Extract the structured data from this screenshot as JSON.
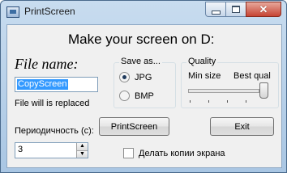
{
  "window": {
    "title": "PrintScreen"
  },
  "heading": "Make your screen on D:",
  "file": {
    "label": "File name:",
    "value": "CopyScreen",
    "note": "File will is replaced"
  },
  "save_as": {
    "title": "Save as...",
    "options": [
      "JPG",
      "BMP"
    ],
    "selected": "JPG"
  },
  "quality": {
    "title": "Quality",
    "min_label": "Min size",
    "max_label": "Best qual",
    "level": 1.0
  },
  "buttons": {
    "printscreen": "PrintScreen",
    "exit": "Exit"
  },
  "period": {
    "label": "Периодичность (с):",
    "value": "3"
  },
  "copies_checkbox": {
    "label": "Делать копии экрана",
    "checked": false
  },
  "icons": {
    "app": "printscreen-app-icon",
    "minimize": "minimize-icon",
    "maximize": "maximize-icon",
    "close": "close-icon"
  }
}
